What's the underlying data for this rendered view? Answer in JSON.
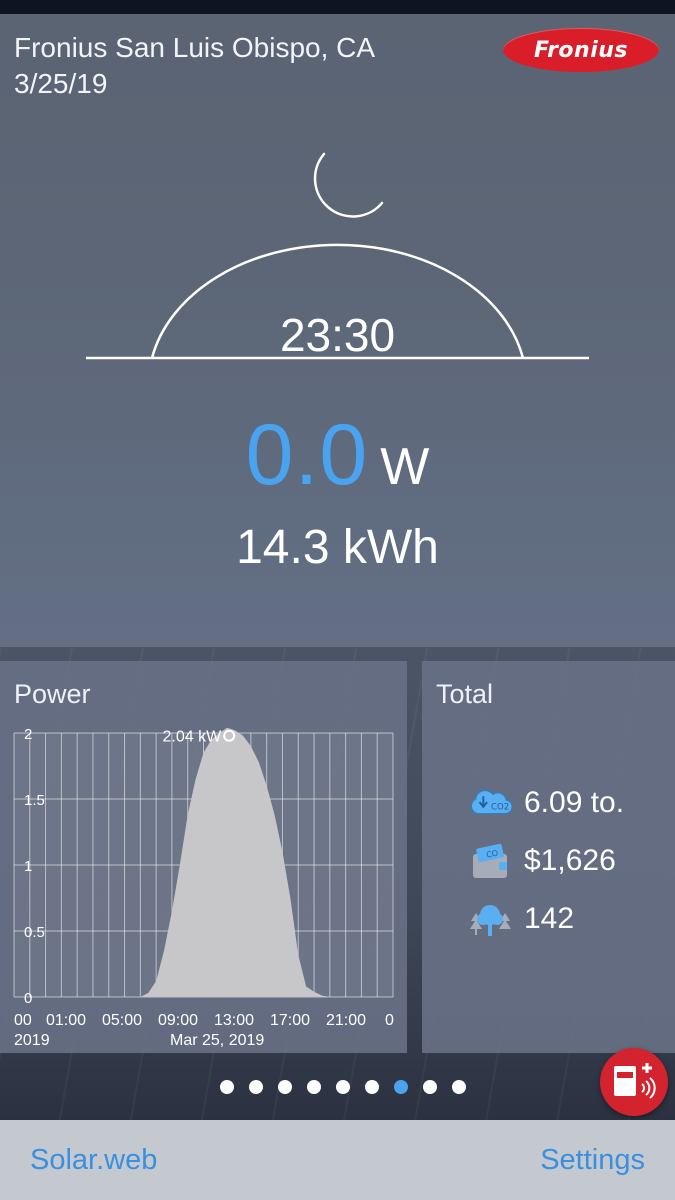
{
  "header": {
    "location": "Fronius San Luis Obispo, CA",
    "date": "3/25/19",
    "logo_text": "Fronius"
  },
  "sun_arc": {
    "time": "23:30",
    "icon": "moon-icon"
  },
  "current": {
    "power_value": "0.0",
    "power_unit": "W",
    "energy_today": "14.3 kWh"
  },
  "power_panel": {
    "title": "Power",
    "peak_label": "2.04 kW",
    "date_label": "Mar 25, 2019",
    "year_label": "2019"
  },
  "chart_data": {
    "type": "area",
    "title": "Power",
    "ylabel": "",
    "xlabel": "Mar 25, 2019",
    "ylim": [
      0,
      2
    ],
    "y_ticks": [
      "0",
      "0.5",
      "1",
      "1.5",
      "2"
    ],
    "x_ticks": [
      "00",
      "01:00",
      "05:00",
      "09:00",
      "13:00",
      "17:00",
      "21:00",
      "0"
    ],
    "x_hours": [
      7.0,
      7.5,
      8.0,
      8.5,
      9.0,
      9.5,
      10.0,
      10.5,
      11.0,
      11.5,
      12.0,
      12.5,
      13.0,
      13.5,
      14.0,
      14.5,
      15.0,
      15.5,
      16.0,
      16.5,
      17.0,
      17.5,
      18.0,
      18.5,
      19.0
    ],
    "values": [
      0.0,
      0.03,
      0.12,
      0.35,
      0.65,
      1.0,
      1.38,
      1.65,
      1.85,
      1.95,
      2.0,
      2.04,
      2.02,
      1.98,
      1.9,
      1.78,
      1.6,
      1.38,
      1.1,
      0.75,
      0.32,
      0.08,
      0.04,
      0.01,
      0.0
    ],
    "peak": {
      "value": 2.04,
      "unit": "kW",
      "hour": 12.5
    },
    "grid": true
  },
  "total_panel": {
    "title": "Total",
    "co2": "6.09 to.",
    "money": "$1,626",
    "trees": "142",
    "co2_icon_label": "CO2",
    "money_icon_label": "CO"
  },
  "pager": {
    "count": 9,
    "active_index": 6
  },
  "tabbar": {
    "left_label": "Solar.web",
    "right_label": "Settings"
  },
  "colors": {
    "accent": "#4aa3ef",
    "brand_red": "#d91e2a",
    "chart_fill": "#c7c7c9"
  }
}
